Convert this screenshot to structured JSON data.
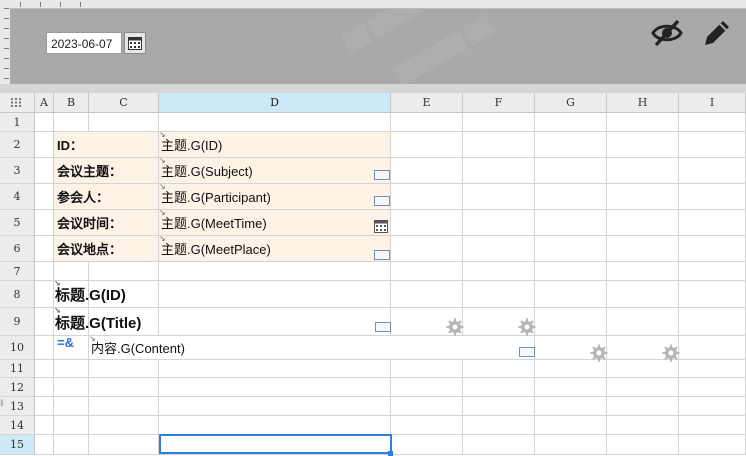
{
  "toolbar": {
    "date_value": "2023-06-07",
    "icons": [
      "calendar-icon",
      "eye-off-icon",
      "pencil-icon"
    ]
  },
  "columns": [
    "A",
    "B",
    "C",
    "D",
    "E",
    "F",
    "G",
    "H",
    "I"
  ],
  "selected_column": "D",
  "rows": [
    "1",
    "2",
    "3",
    "4",
    "5",
    "6",
    "7",
    "8",
    "9",
    "10",
    "11",
    "12",
    "13",
    "14",
    "15"
  ],
  "selected_row": "15",
  "form": {
    "id_label": "ID：",
    "id_formula": "主题.G(ID)",
    "subject_label": "会议主题：",
    "subject_formula": "主题.G(Subject)",
    "participant_label": "参会人：",
    "participant_formula": "主题.G(Participant)",
    "time_label": "会议时间：",
    "time_formula": "主题.G(MeetTime)",
    "place_label": "会议地点：",
    "place_formula": "主题.G(MeetPlace)"
  },
  "detail": {
    "title_id": "标题.G(ID)",
    "title_title": "标题.G(Title)",
    "link_text": "=&\n...",
    "content_formula": "内容.G(Content)"
  },
  "colors": {
    "top_panel": "#a9a9a9",
    "header_selected": "#cde8f6",
    "peach_fill": "#fdf2e6",
    "selection": "#2f7de1",
    "link": "#2b6fd6"
  }
}
